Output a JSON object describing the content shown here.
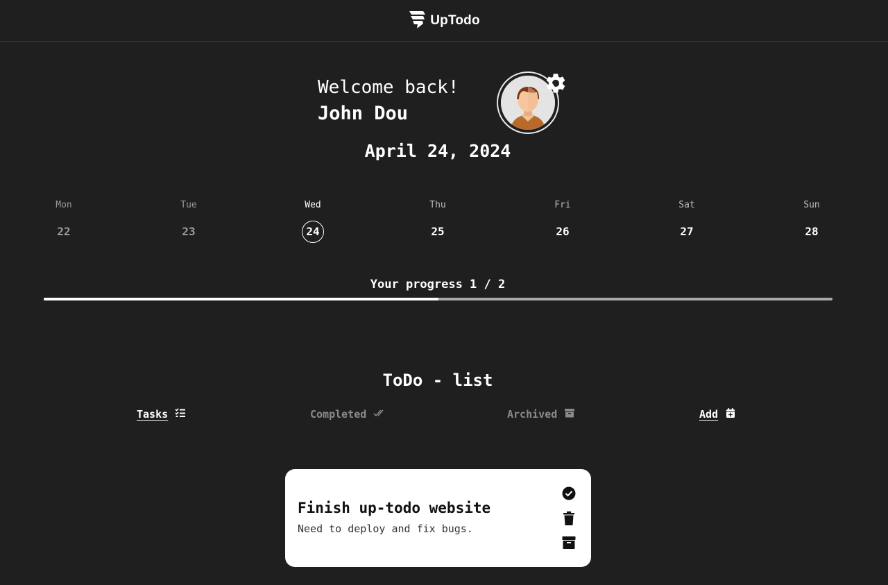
{
  "header": {
    "app_name": "UpTodo",
    "logo_icon": "uptodo-logo-icon"
  },
  "welcome": {
    "greeting": "Welcome back!",
    "user_name": "John Dou"
  },
  "profile": {
    "avatar_icon": "avatar-icon",
    "settings_icon": "gear-icon"
  },
  "date": "April 24, 2024",
  "week": [
    {
      "name": "Mon",
      "num": "22",
      "state": "past"
    },
    {
      "name": "Tue",
      "num": "23",
      "state": "past"
    },
    {
      "name": "Wed",
      "num": "24",
      "state": "today"
    },
    {
      "name": "Thu",
      "num": "25",
      "state": "future"
    },
    {
      "name": "Fri",
      "num": "26",
      "state": "future"
    },
    {
      "name": "Sat",
      "num": "27",
      "state": "future"
    },
    {
      "name": "Sun",
      "num": "28",
      "state": "future"
    }
  ],
  "progress": {
    "label": "Your progress 1 / 2",
    "done": 1,
    "total": 2
  },
  "todo": {
    "title": "ToDo - list",
    "tabs": [
      {
        "label": "Tasks",
        "icon": "checklist-icon",
        "active": true
      },
      {
        "label": "Completed",
        "icon": "double-check-icon",
        "active": false
      },
      {
        "label": "Archived",
        "icon": "archive-box-icon",
        "active": false
      },
      {
        "label": "Add",
        "icon": "calendar-plus-icon",
        "active": true
      }
    ],
    "tasks": [
      {
        "title": "Finish up-todo website",
        "description": "Need to deploy and fix bugs.",
        "actions": [
          "check-circle-icon",
          "trash-icon",
          "archive-icon"
        ]
      }
    ]
  },
  "colors": {
    "background": "#1f1f1f",
    "card": "#ffffff",
    "muted": "#8a8a8a",
    "track": "#a9a9a9"
  }
}
